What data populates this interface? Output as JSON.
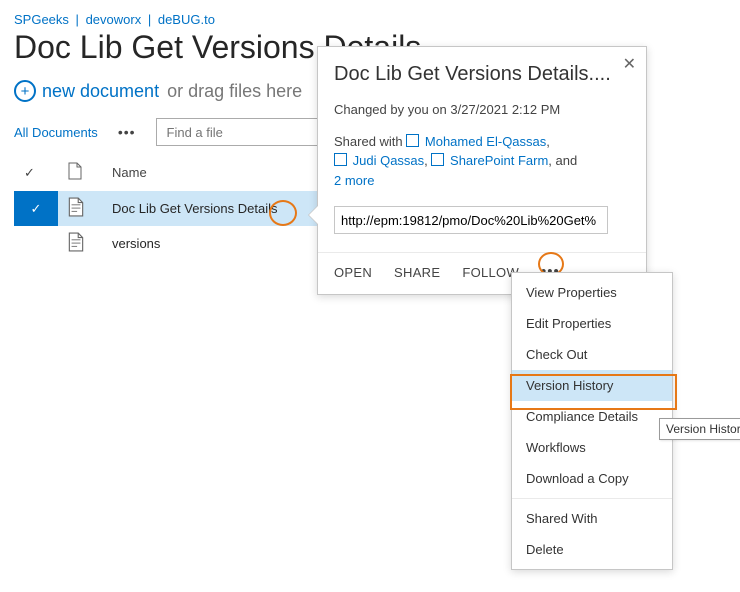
{
  "breadcrumb": {
    "items": [
      "SPGeeks",
      "devoworx",
      "deBUG.to"
    ]
  },
  "page_title": "Doc Lib Get Versions Details",
  "newdoc": {
    "link": "new document",
    "hint": "or drag files here"
  },
  "views": {
    "current": "All Documents",
    "find_placeholder": "Find a file"
  },
  "columns": {
    "name": "Name"
  },
  "rows": [
    {
      "name": "Doc Lib Get Versions Details",
      "selected": true
    },
    {
      "name": "versions",
      "selected": false
    }
  ],
  "callout": {
    "title": "Doc Lib Get Versions Details....",
    "changed_line_prefix": "Changed by you on ",
    "changed_date": "3/27/2021 2:12 PM",
    "shared_prefix": "Shared with ",
    "shared_people": [
      "Mohamed El-Qassas",
      "Judi Qassas",
      "SharePoint Farm"
    ],
    "shared_suffix_join": ", and ",
    "shared_more": "2 more",
    "url": "http://epm:19812/pmo/Doc%20Lib%20Get%",
    "actions": {
      "open": "OPEN",
      "share": "SHARE",
      "follow": "FOLLOW"
    }
  },
  "context_menu": {
    "items": [
      "View Properties",
      "Edit Properties",
      "Check Out",
      "Version History",
      "Compliance Details",
      "Workflows",
      "Download a Copy"
    ],
    "items2": [
      "Shared With",
      "Delete"
    ],
    "highlighted": "Version History"
  },
  "tooltip": "Version History"
}
